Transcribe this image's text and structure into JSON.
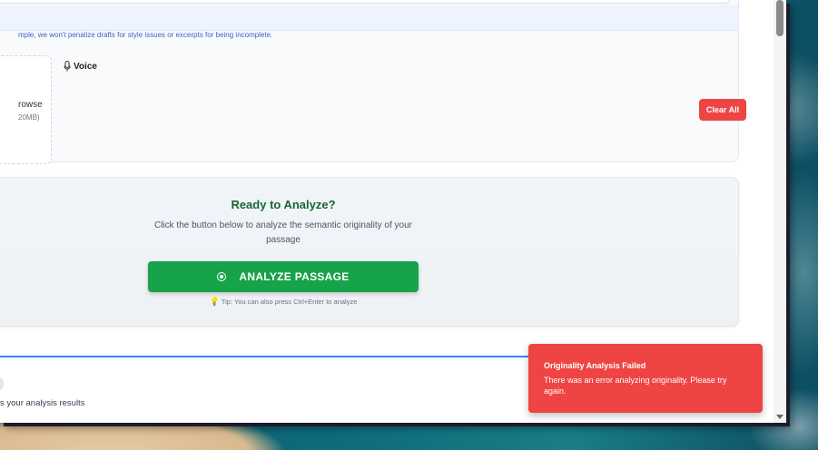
{
  "editor": {
    "hint": "mple, we won't penalize drafts for style issues or excerpts for being incomplete.",
    "resize_glyph": "//"
  },
  "upload": {
    "label": "rowse",
    "size": "20MB)"
  },
  "voice": {
    "label": "Voice",
    "icon": "microphone-icon"
  },
  "clear_all": {
    "label": "Clear All"
  },
  "analyze": {
    "title": "Ready to Analyze?",
    "description": "Click the button below to analyze the semantic originality of your passage",
    "button_label": "ANALYZE PASSAGE",
    "button_icon": "target-icon",
    "tip": "Tip: You can also press Ctrl+Enter to analyze",
    "tip_icon": "lightbulb-icon"
  },
  "results": {
    "text": "s your analysis results"
  },
  "toast": {
    "title": "Originality Analysis Failed",
    "message": "There was an error analyzing originality. Please try again."
  },
  "colors": {
    "primary_green": "#16a34a",
    "title_green": "#166534",
    "danger_red": "#ef4444",
    "results_accent": "#3b82f6"
  }
}
